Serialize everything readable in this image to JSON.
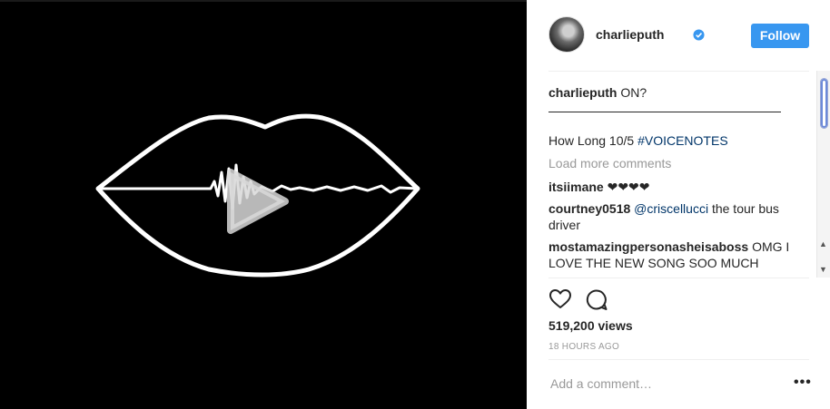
{
  "post": {
    "username": "charlieputh",
    "follow_label": "Follow",
    "caption_user": "charlieputh",
    "caption_text": " ON?",
    "caption_line2": "How Long 10/5 ",
    "caption_hashtag": "#VOICENOTES",
    "load_more": "Load more comments",
    "comments": [
      {
        "user": "itsiimane",
        "text": " ❤❤❤❤"
      },
      {
        "user": "courtney0518",
        "mention": "@criscellucci",
        "text": " the tour bus driver"
      },
      {
        "user": "mostamazingpersonasheisaboss",
        "text": " OMG I LOVE THE NEW SONG SOO MUCH"
      }
    ],
    "views": "519,200 views",
    "time": "18 HOURS AGO",
    "add_comment_placeholder": "Add a comment…",
    "more_label": "•••"
  },
  "colors": {
    "follow_button": "#3897f0",
    "hashtag": "#003569",
    "muted": "#999999"
  },
  "icons": [
    "verified-badge-icon",
    "heart-icon",
    "comment-icon",
    "play-icon",
    "more-options-icon"
  ]
}
